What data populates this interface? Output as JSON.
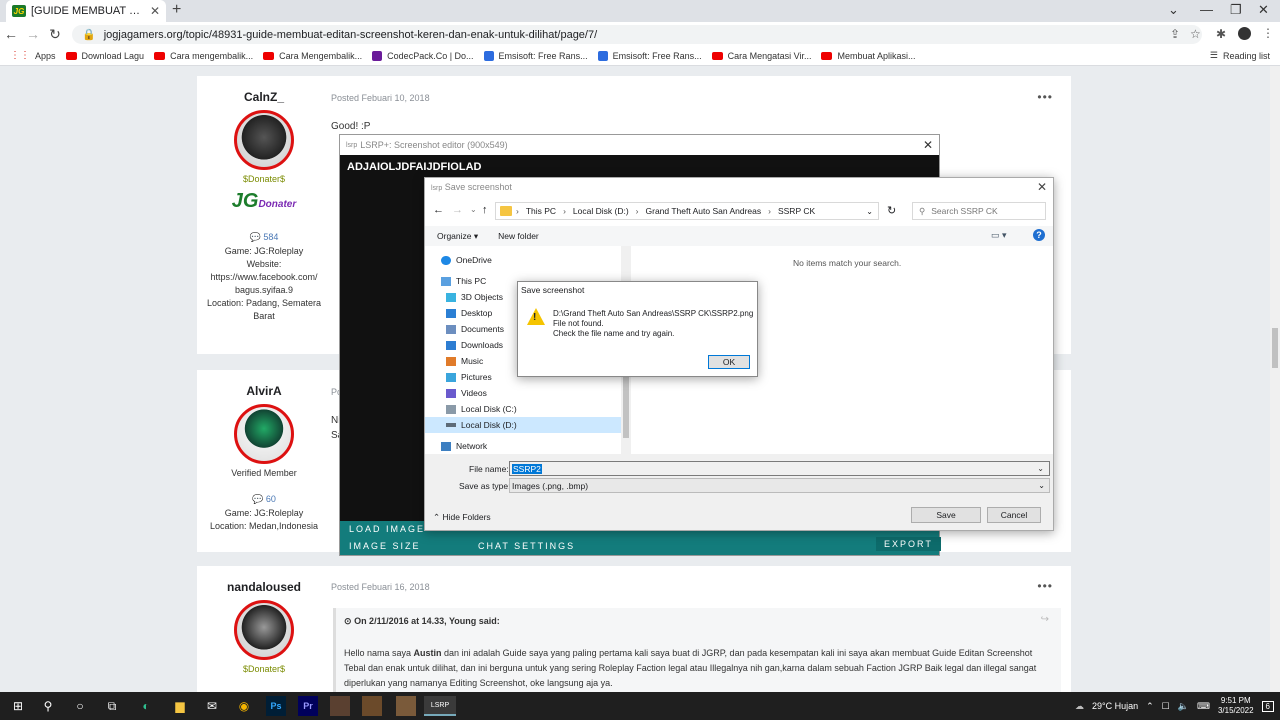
{
  "browser": {
    "tab_title": "[GUIDE MEMBUAT EDITAN SCRE",
    "favicon_text": "JG",
    "url": "jogjagamers.org/topic/48931-guide-membuat-editan-screenshot-keren-dan-enak-untuk-dilihat/page/7/",
    "bookmarks": [
      {
        "label": "Apps",
        "icon": "apps-grid-icon"
      },
      {
        "label": "Download Lagu",
        "icon": "youtube-icon"
      },
      {
        "label": "Cara mengembalik...",
        "icon": "youtube-icon"
      },
      {
        "label": "Cara Mengembalik...",
        "icon": "youtube-icon"
      },
      {
        "label": "CodecPack.Co | Do...",
        "icon": "codecpack-icon"
      },
      {
        "label": "Emsisoft: Free Rans...",
        "icon": "emsisoft-icon"
      },
      {
        "label": "Emsisoft: Free Rans...",
        "icon": "emsisoft-icon"
      },
      {
        "label": "Cara Mengatasi Vir...",
        "icon": "youtube-icon"
      },
      {
        "label": "Membuat Aplikasi...",
        "icon": "youtube-icon"
      }
    ],
    "reading_list": "Reading list"
  },
  "posts": [
    {
      "author": "CalnZ_",
      "rank": "$Donater$",
      "badge_main": "JG",
      "badge_sub": "Donater",
      "count": "584",
      "info": [
        "Game: JG:Roleplay",
        "Website:",
        "https://www.facebook.com/",
        "bagus.syifaa.9",
        "Location: Padang, Sematera",
        "Barat"
      ],
      "date": "Posted Febuari 10, 2018",
      "body": "Good!",
      "img_alt": ":P"
    },
    {
      "author": "AlvirA",
      "rank": "Verified Member",
      "count": "60",
      "info": [
        "Game: JG:Roleplay",
        "Location: Medan,Indonesia"
      ],
      "date_stub": "Po",
      "body_stub1": "Ni",
      "body_stub2": "Sa"
    },
    {
      "author": "nandaloused",
      "rank": "$Donater$",
      "date": "Posted Febuari 16, 2018",
      "quote_header": "On 2/11/2016 at 14.33, Young said:",
      "quote_lead": "Hello nama saya ",
      "quote_bold": "Austin",
      "quote_rest": " dan ini adalah Guide saya yang paling pertama kali saya buat di JGRP, dan pada kesempatan kali ini saya akan membuat Guide Editan Screenshot Tebal dan enak untuk dilihat, dan ini berguna untuk yang sering Roleplay Faction legal atau Illegalnya nih gan,karna dalam sebuah Faction JGRP Baik legal dan illegal sangat diperlukan yang namanya Editing Screenshot, oke langsung aja ya."
    }
  ],
  "lsrp": {
    "title": "LSRP+: Screenshot editor (900x549)",
    "canvas_text": "ADJAIOLJDFAIJDFIOLAD",
    "load_image": "LOAD IMAGE",
    "image_size": "IMAGE SIZE",
    "chat_settings": "CHAT SETTINGS",
    "export": "EXPORT"
  },
  "save_dialog": {
    "title": "Save screenshot",
    "breadcrumbs": [
      "This PC",
      "Local Disk (D:)",
      "Grand Theft Auto  San Andreas",
      "SSRP CK"
    ],
    "search_placeholder": "Search SSRP CK",
    "organize": "Organize ▾",
    "new_folder": "New folder",
    "tree": [
      {
        "label": "OneDrive",
        "icon": "onedrive-icon",
        "indent": 1
      },
      {
        "label": "This PC",
        "icon": "computer-icon",
        "indent": 1
      },
      {
        "label": "3D Objects",
        "icon": "3d-objects-icon",
        "indent": 2
      },
      {
        "label": "Desktop",
        "icon": "desktop-icon",
        "indent": 2
      },
      {
        "label": "Documents",
        "icon": "documents-icon",
        "indent": 2
      },
      {
        "label": "Downloads",
        "icon": "downloads-icon",
        "indent": 2
      },
      {
        "label": "Music",
        "icon": "music-icon",
        "indent": 2
      },
      {
        "label": "Pictures",
        "icon": "pictures-icon",
        "indent": 2
      },
      {
        "label": "Videos",
        "icon": "videos-icon",
        "indent": 2
      },
      {
        "label": "Local Disk (C:)",
        "icon": "drive-icon",
        "indent": 2
      },
      {
        "label": "Local Disk (D:)",
        "icon": "drive-icon",
        "indent": 2,
        "selected": true
      },
      {
        "label": "Network",
        "icon": "network-icon",
        "indent": 1
      }
    ],
    "empty_message": "No items match your search.",
    "file_name_label": "File name:",
    "file_name_value": "SSRP2",
    "save_type_label": "Save as type:",
    "save_type_value": "Images (.png, .bmp)",
    "hide_folders": "Hide Folders",
    "save_button": "Save",
    "cancel_button": "Cancel"
  },
  "error_dialog": {
    "title": "Save screenshot",
    "line1": "D:\\Grand Theft Auto  San Andreas\\SSRP CK\\SSRP2.png",
    "line2": "File not found.",
    "line3": "Check the file name and try again.",
    "ok_button": "OK"
  },
  "taskbar": {
    "weather": "29°C  Hujan",
    "time": "9:51 PM",
    "date": "3/15/2022",
    "app_label": "LSRP",
    "notification_count": "6"
  },
  "colors": {
    "accent_teal": "#137c7c",
    "link_blue": "#0078d7",
    "avatar_ring": "#dd1111",
    "donater_green": "#7a8b00"
  }
}
